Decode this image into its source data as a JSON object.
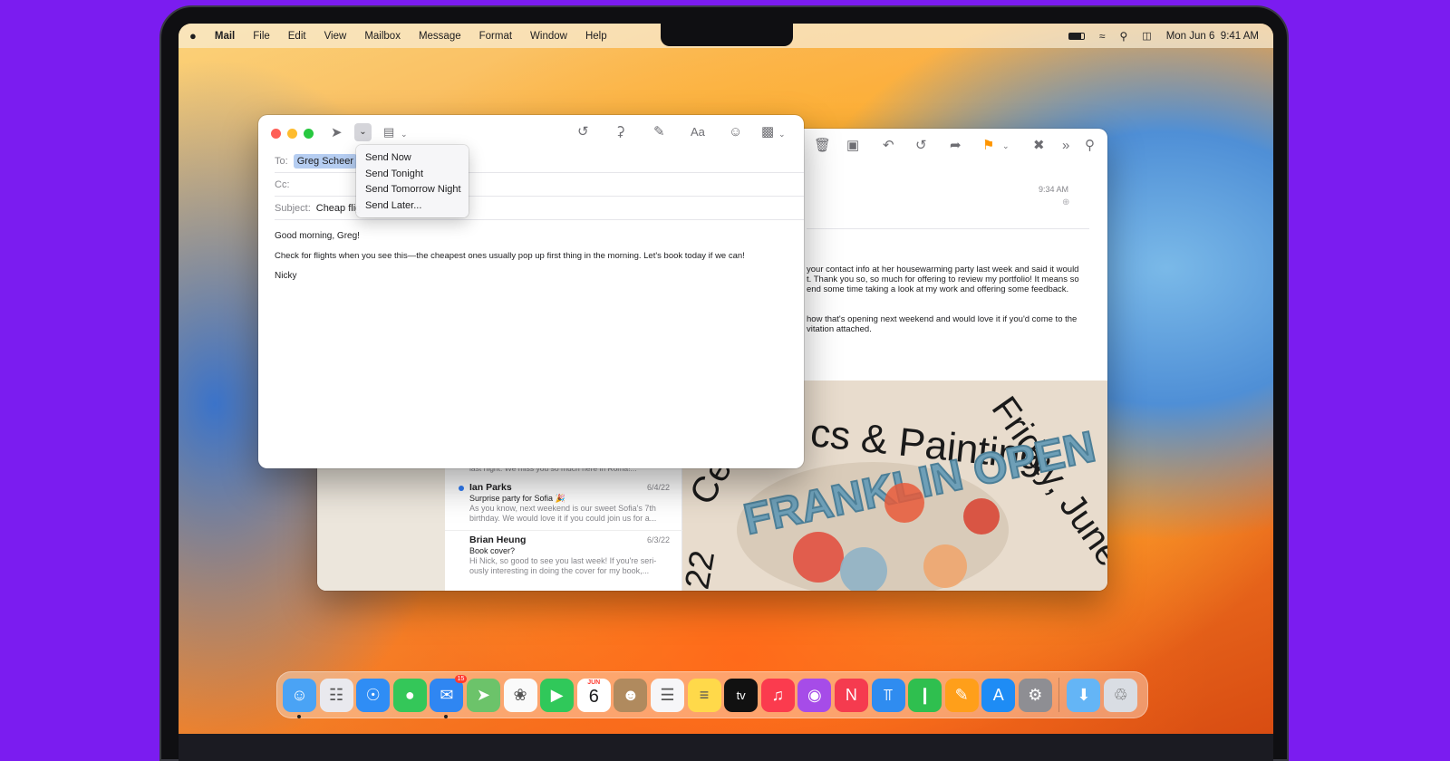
{
  "menubar": {
    "apple": "",
    "items": [
      "Mail",
      "File",
      "Edit",
      "View",
      "Mailbox",
      "Message",
      "Format",
      "Window",
      "Help"
    ],
    "date": "Mon Jun 6",
    "time": "9:41 AM"
  },
  "compose": {
    "to_label": "To:",
    "to_value": "Greg Scheer",
    "cc_label": "Cc:",
    "subject_label": "Subject:",
    "subject_value": "Cheap flig",
    "greeting": "Good morning, Greg!",
    "body": "Check for flights when you see this—the cheapest ones usually pop up first thing in the morning. Let's book today if we can!",
    "signature": "Nicky",
    "font_button": "Aa"
  },
  "send_menu": {
    "items": [
      "Send Now",
      "Send Tonight",
      "Send Tomorrow Night",
      "Send Later..."
    ]
  },
  "reader": {
    "time": "9:34 AM",
    "para1": [
      "your contact info at her housewarming party last week and said it would",
      "t. Thank you so, so much for offering to review my portfolio! It means so",
      "end some time taking a look at my work and offering some feedback."
    ],
    "para2": [
      "how that's opening next weekend and would love it if you'd come to the",
      "vitation attached."
    ],
    "poster_title": "Ceramics & Painting",
    "poster_title_visible": "cs & Painting",
    "poster_date": "Friday, June",
    "poster_ce": "Ce",
    "poster_year": "22",
    "poster_art": "FRANKLIN OPEN"
  },
  "messages": [
    {
      "sender": "",
      "date": "",
      "subject": "",
      "preview1": "last night. We miss you so much here in Roma!...",
      "preview2": "",
      "unread": false
    },
    {
      "sender": "Ian Parks",
      "date": "6/4/22",
      "subject": "Surprise party for Sofia 🎉",
      "preview1": "As you know, next weekend is our sweet Sofia's 7th",
      "preview2": "birthday. We would love it if you could join us for a...",
      "unread": true
    },
    {
      "sender": "Brian Heung",
      "date": "6/3/22",
      "subject": "Book cover?",
      "preview1": "Hi Nick, so good to see you last week! If you're seri-",
      "preview2": "ously interesting in doing the cover for my book,...",
      "unread": false
    }
  ],
  "dock": {
    "mail_badge": "15",
    "calendar_month": "JUN",
    "calendar_day": "6",
    "apps": [
      {
        "name": "finder-icon",
        "color": "#4aa3f5",
        "glyph": "☺",
        "running": true
      },
      {
        "name": "launchpad-icon",
        "color": "#e9e9ee",
        "glyph": "☷",
        "running": false
      },
      {
        "name": "safari-icon",
        "color": "#2f8df5",
        "glyph": "☉",
        "running": false
      },
      {
        "name": "messages-icon",
        "color": "#34c759",
        "glyph": "●",
        "running": false
      },
      {
        "name": "mail-icon",
        "color": "#2f86f2",
        "glyph": "✉",
        "running": true
      },
      {
        "name": "maps-icon",
        "color": "#6cc36a",
        "glyph": "➤",
        "running": false
      },
      {
        "name": "photos-icon",
        "color": "#fafafa",
        "glyph": "❀",
        "running": false
      },
      {
        "name": "facetime-icon",
        "color": "#30c85a",
        "glyph": "▶",
        "running": false
      },
      {
        "name": "calendar-icon",
        "color": "#ffffff",
        "glyph": "",
        "running": false
      },
      {
        "name": "contacts-icon",
        "color": "#b08a5e",
        "glyph": "☻",
        "running": false
      },
      {
        "name": "reminders-icon",
        "color": "#f6f6f8",
        "glyph": "☰",
        "running": false
      },
      {
        "name": "notes-icon",
        "color": "#ffd94a",
        "glyph": "≡",
        "running": false
      },
      {
        "name": "tv-icon",
        "color": "#111111",
        "glyph": "tv",
        "running": false
      },
      {
        "name": "music-icon",
        "color": "#fb3b4e",
        "glyph": "♫",
        "running": false
      },
      {
        "name": "podcasts-icon",
        "color": "#a64ce8",
        "glyph": "◉",
        "running": false
      },
      {
        "name": "news-icon",
        "color": "#f53b4f",
        "glyph": "N",
        "running": false
      },
      {
        "name": "keynote-icon",
        "color": "#2f8cf0",
        "glyph": "⫪",
        "running": false
      },
      {
        "name": "numbers-icon",
        "color": "#2fbf4f",
        "glyph": "❙",
        "running": false
      },
      {
        "name": "pages-icon",
        "color": "#ff9f1a",
        "glyph": "✎",
        "running": false
      },
      {
        "name": "app-store-icon",
        "color": "#1e8cf5",
        "glyph": "A",
        "running": false
      },
      {
        "name": "system-settings-icon",
        "color": "#8e8e93",
        "glyph": "⚙",
        "running": false
      }
    ],
    "extras": [
      {
        "name": "downloads-folder-icon",
        "color": "#64b5f6",
        "glyph": "⬇"
      },
      {
        "name": "trash-icon",
        "color": "#d9dde3",
        "glyph": "♲"
      }
    ]
  }
}
